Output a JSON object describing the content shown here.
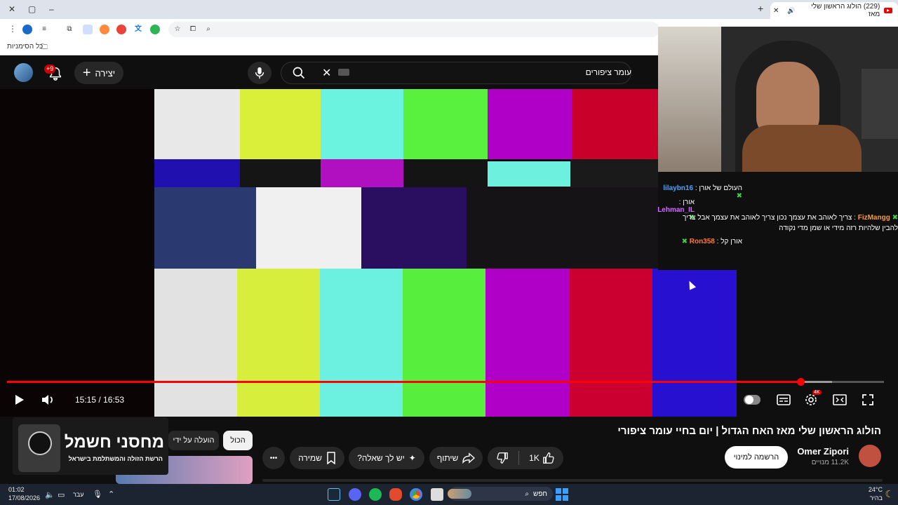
{
  "browser": {
    "tab_title": "(229) הולוג הראשון שלי מאז",
    "bookmarks_label": "כל הסימניות",
    "controls": {
      "new_tab": "+",
      "close_tab": "✕",
      "minimize": "–",
      "restore": "▢",
      "close": "✕"
    }
  },
  "youtube": {
    "create_label": "יצירה",
    "notifications_badge": "+9",
    "search_query": "עומר ציפורים"
  },
  "chat": {
    "lines": [
      {
        "user": "lilaybn16",
        "message": "העולם של אורן",
        "user_color": "#4aa3ff"
      },
      {
        "user": "Lehman_IL",
        "message": "אורן",
        "user_color": "#d36cff"
      },
      {
        "user": "FizMangg",
        "message": "צריך לאוהב את עצמך נכון צריך לאוהב את עצמך אבל צריך להבין שלהיות רזה מידי או שמן מדי נקודה",
        "user_color": "#ff9b30"
      },
      {
        "user": "Ron358",
        "message": "אורן קל",
        "user_color": "#ff7b30"
      }
    ]
  },
  "player": {
    "time_display": "15:15 / 16:53",
    "progress": 0.905,
    "quality_badge": "4K"
  },
  "video_info": {
    "title": "הולוג הראשון שלי מאז האח הגדול | יום בחיי עומר ציפורי",
    "channel_name": "Omer Zipori",
    "subscribers": "11.2K מנויים",
    "subscribe_label": "הרשמה למינוי",
    "like_count": "1K",
    "share_label": "שיתוף",
    "ask_label": "יש לך שאלה?",
    "save_label": "שמירה",
    "more_label": "•••"
  },
  "recommendations": {
    "chips": [
      "הכול",
      "הועלה על ידי"
    ]
  },
  "watermark": {
    "brand": "מחסני חשמל",
    "tagline": "הרשת הזולה והמשתלמת בישראל"
  },
  "taskbar": {
    "time": "01:02",
    "date": "17/08/2026",
    "language": "עבר",
    "search_label": "חפש",
    "weather_temp": "24°C",
    "weather_desc": "בהיר"
  }
}
